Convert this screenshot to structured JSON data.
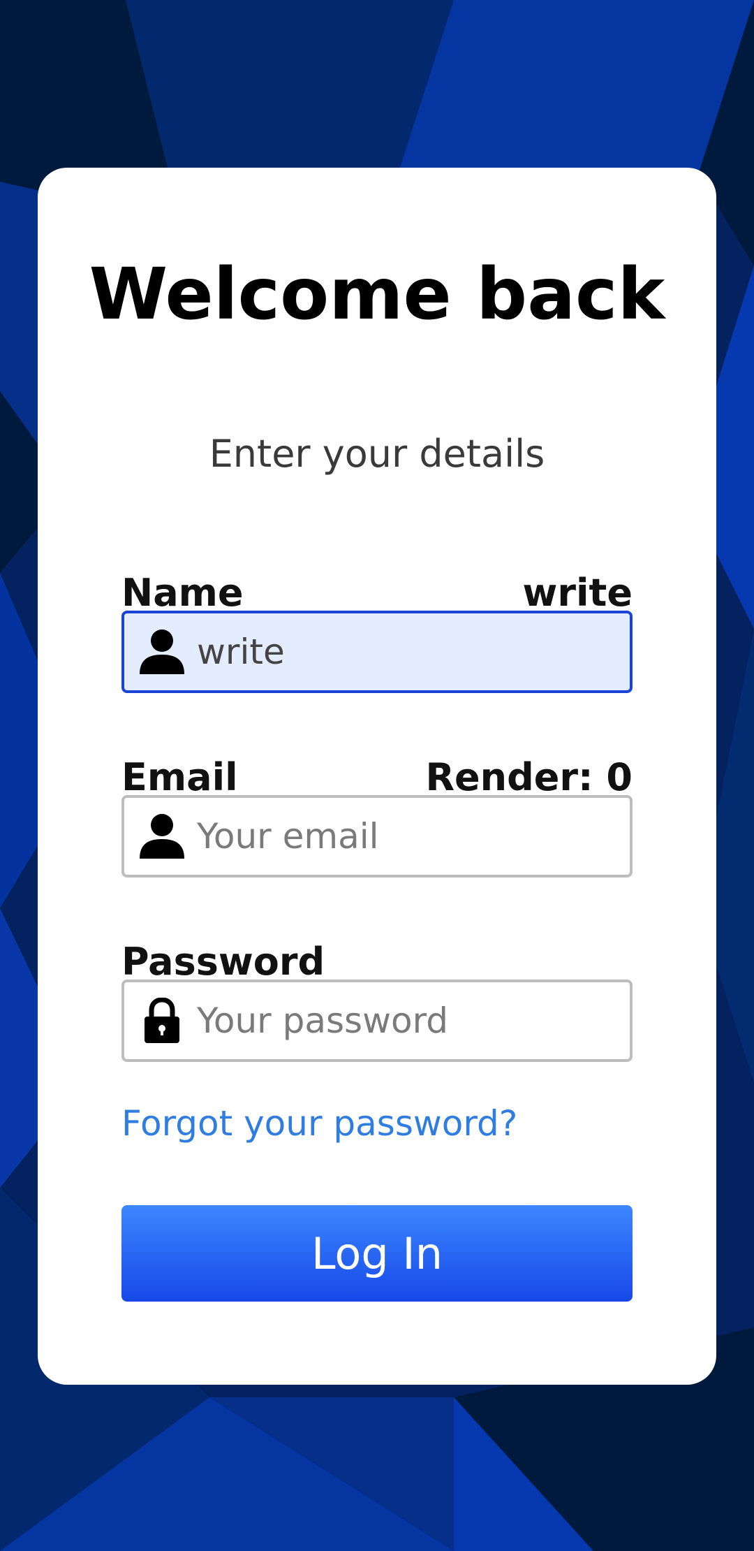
{
  "background": {
    "colors": [
      "#001a3d",
      "#022b70",
      "#0a37a8",
      "#0630a0"
    ]
  },
  "card": {
    "title": "Welcome back",
    "subtitle": "Enter your details"
  },
  "form": {
    "name": {
      "label": "Name",
      "status": "write",
      "value": "write",
      "placeholder": "",
      "icon": "user-icon"
    },
    "email": {
      "label": "Email",
      "status": "Render: 0",
      "value": "",
      "placeholder": "Your email",
      "icon": "user-icon"
    },
    "password": {
      "label": "Password",
      "value": "",
      "placeholder": "Your password",
      "icon": "lock-icon"
    },
    "forgot_link": "Forgot your password?",
    "login_button": "Log In"
  },
  "colors": {
    "accent": "#1a44d6",
    "link": "#2f7de0",
    "button_top": "#3d87ff",
    "button_bottom": "#1648e8"
  }
}
